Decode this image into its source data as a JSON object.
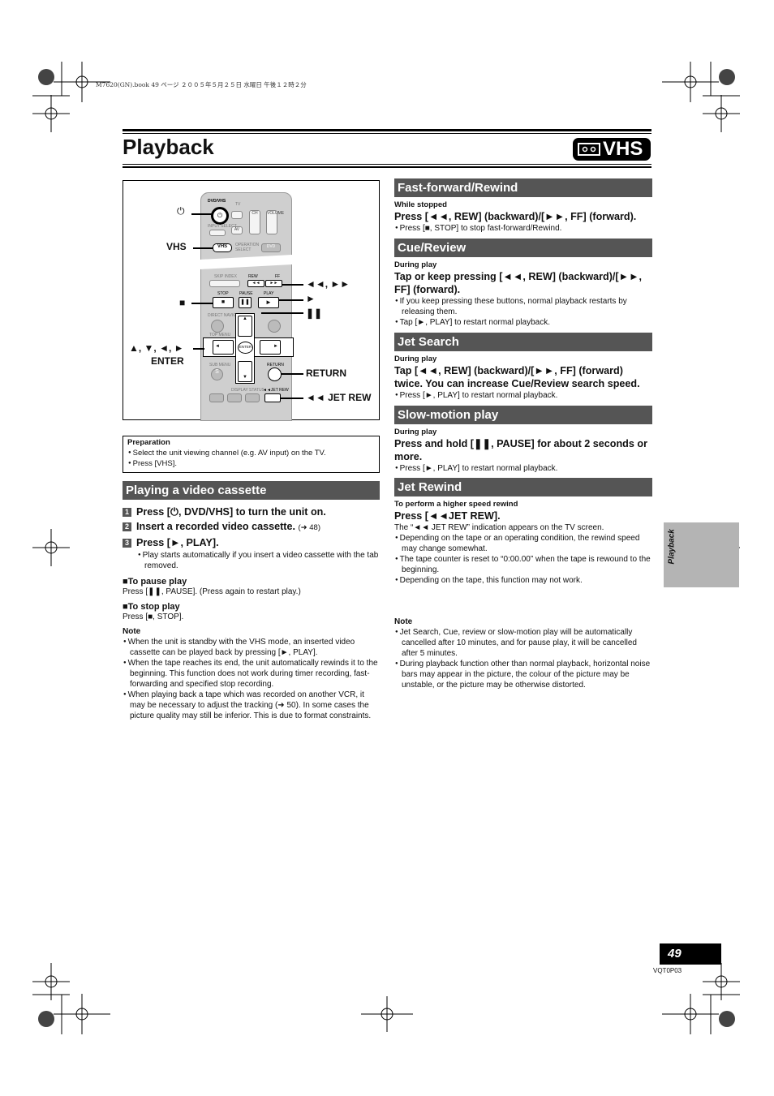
{
  "print_header": "M7620(GN).book  49 ページ  ２００５年５月２５日  水曜日  午後１２時２分",
  "title": "Playback",
  "badge": "VHS",
  "remote": {
    "callouts": {
      "power": "⏻",
      "vhs": "VHS",
      "stop": "■",
      "arrows": "▲, ▼, ◄, ►",
      "enter": "ENTER",
      "rew_ff": "◄◄, ►►",
      "play": "►",
      "pause": "❚❚",
      "return": "RETURN",
      "jet_rew": "◄◄ JET REW"
    },
    "keys": {
      "dvd_vhs": "DVD/VHS",
      "tv": "TV",
      "input_select": "INPUT SELECT",
      "av": "AV",
      "ch": "CH",
      "volume": "VOLUME",
      "vhs": "VHS",
      "operation_select": "OPERATION SELECT",
      "dvd": "DVD",
      "skip_index": "SKIP INDEX",
      "rew": "REW",
      "search": "SEARCH",
      "ff": "FF",
      "stop": "STOP",
      "pause": "PAUSE",
      "play": "PLAY",
      "direct_navigator": "DIRECT NAVIGATOR",
      "top_menu": "TOP MENU",
      "enter": "ENTER",
      "sub_menu": "SUB MENU",
      "return": "RETURN",
      "display": "DISPLAY",
      "status": "STATUS",
      "jet_rew": "◄◄JET REW"
    }
  },
  "preparation": {
    "heading": "Preparation",
    "items": [
      "Select the unit viewing channel (e.g. AV input) on the TV.",
      "Press [VHS]."
    ]
  },
  "playing": {
    "title": "Playing a video cassette",
    "steps": [
      {
        "n": "1",
        "text": "Press [⏻, DVD/VHS] to turn the unit on.",
        "ref": ""
      },
      {
        "n": "2",
        "text": "Insert a recorded video cassette.",
        "ref": "(➜ 48)"
      },
      {
        "n": "3",
        "text": "Press [►, PLAY].",
        "ref": ""
      }
    ],
    "step3_note": "Play starts automatically if you insert a video cassette with the tab removed.",
    "pause_heading": "■To pause play",
    "pause_text": "Press [❚❚, PAUSE]. (Press again to restart play.)",
    "stop_heading": "■To stop play",
    "stop_text": "Press [■, STOP].",
    "note_heading": "Note",
    "notes": [
      "When the unit is standby with the VHS mode, an inserted video cassette can be played back by pressing [►, PLAY].",
      "When the tape reaches its end, the unit automatically rewinds it to the beginning. This function does not work during timer recording, fast-forwarding and specified stop recording.",
      "When playing back a tape which was recorded on another VCR, it may be necessary to adjust the tracking (➜ 50). In some cases the picture quality may still be inferior. This is due to format constraints."
    ]
  },
  "sections": [
    {
      "title": "Fast-forward/Rewind",
      "sub": "While stopped",
      "main": "Press [◄◄, REW] (backward)/[►►, FF] (forward).",
      "plain": "",
      "bullets": [
        "Press [■, STOP] to stop fast-forward/Rewind."
      ]
    },
    {
      "title": "Cue/Review",
      "sub": "During play",
      "main": "Tap or keep pressing [◄◄, REW] (backward)/[►►, FF] (forward).",
      "plain": "",
      "bullets": [
        "If you keep pressing these buttons, normal playback restarts by releasing them.",
        "Tap [►, PLAY] to restart normal playback."
      ]
    },
    {
      "title": "Jet Search",
      "sub": "During play",
      "main": "Tap [◄◄, REW] (backward)/[►►, FF] (forward) twice. You can increase Cue/Review search speed.",
      "plain": "",
      "bullets": [
        "Press [►, PLAY] to restart normal playback."
      ]
    },
    {
      "title": "Slow-motion play",
      "sub": "During play",
      "main": "Press and hold [❚❚, PAUSE] for about 2 seconds or more.",
      "plain": "",
      "bullets": [
        "Press [►, PLAY] to restart normal playback."
      ]
    },
    {
      "title": "Jet Rewind",
      "sub": "To perform a higher speed rewind",
      "main": "Press [◄◄JET REW].",
      "plain": "The “◄◄ JET REW” indication appears on the TV screen.",
      "bullets": [
        "Depending on the tape or an operating condition, the rewind speed may change somewhat.",
        "The tape counter is reset to “0:00.00” when the tape is rewound to the beginning.",
        "Depending on the tape, this function may not work."
      ]
    }
  ],
  "right_note": {
    "heading": "Note",
    "items": [
      "Jet Search, Cue, review or slow-motion play will be automatically cancelled after 10 minutes, and for pause play, it will be cancelled after 5 minutes.",
      "During playback function other than normal playback, horizontal noise bars may appear in the picture, the colour of the picture may be unstable, or the picture may be otherwise distorted."
    ]
  },
  "side_tab": "Playback",
  "page_number": "49",
  "doc_code": "VQT0P03",
  "colors": {
    "section_bar": "#555555",
    "side_tab": "#b4b4b4",
    "text": "#111111"
  }
}
